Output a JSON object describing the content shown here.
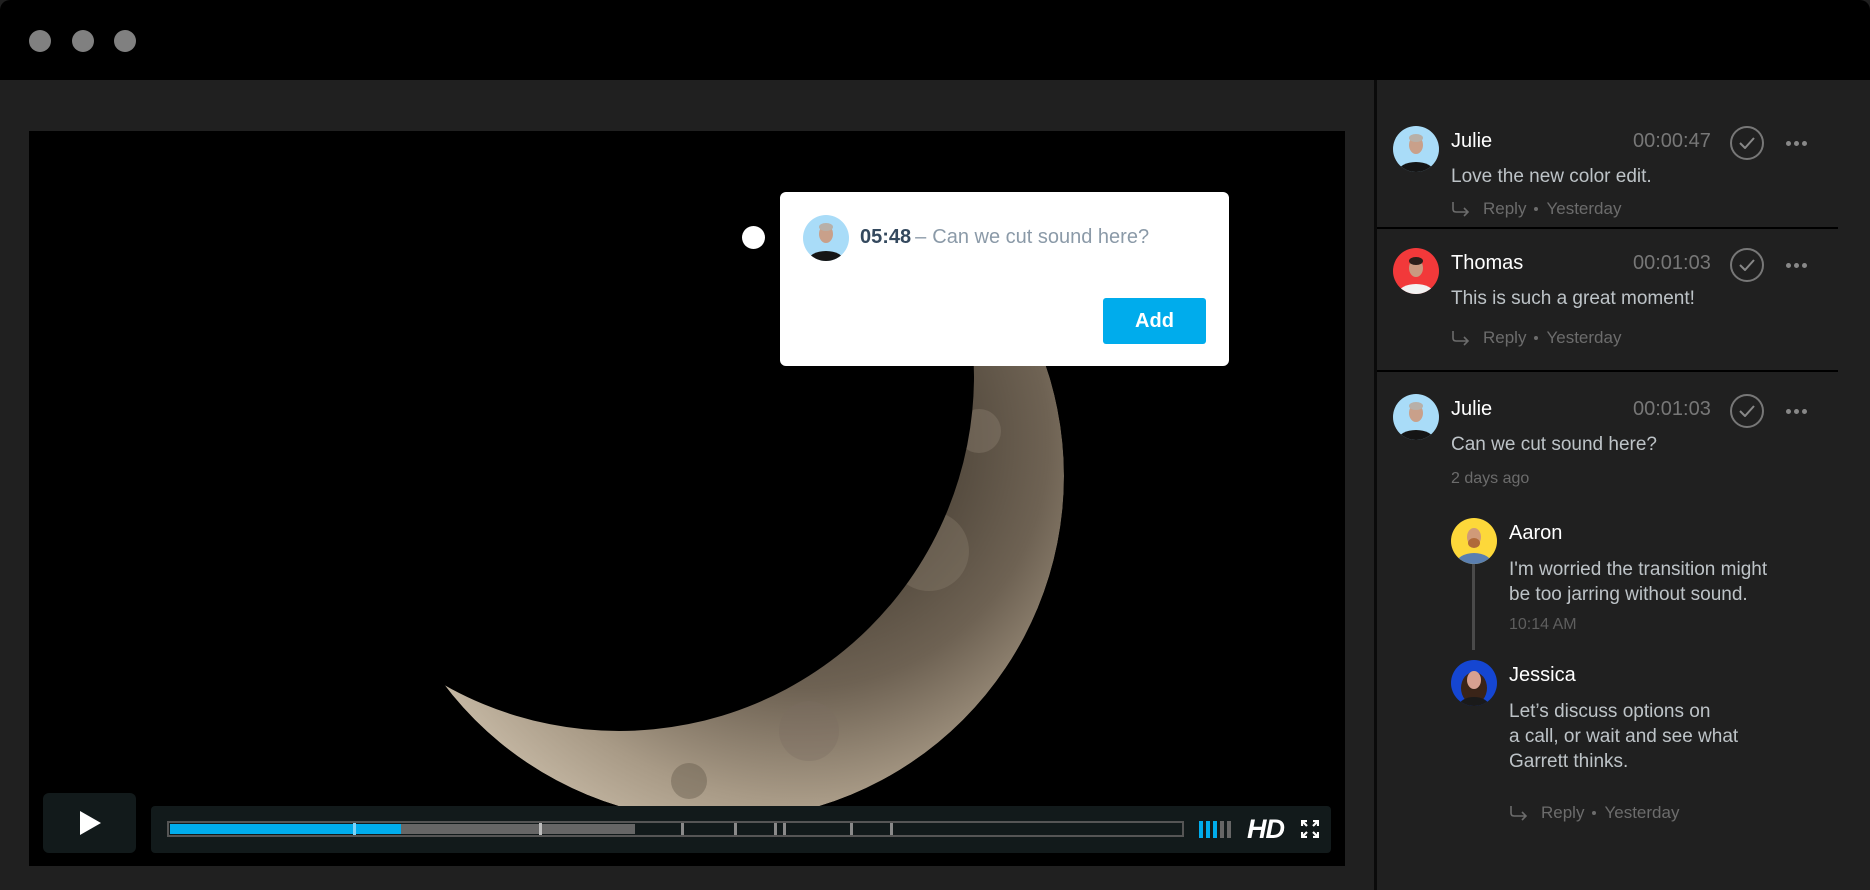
{
  "window": {
    "traffic_lights": [
      "close",
      "minimize",
      "maximize"
    ]
  },
  "player": {
    "state": "paused",
    "play_icon": "play-icon",
    "progress": {
      "played_fraction": 0.228,
      "buffered_fraction": 0.46,
      "comment_markers_fraction": [
        0.182,
        0.366,
        0.506,
        0.559,
        0.598,
        0.607,
        0.674,
        0.713
      ]
    },
    "volume_level": 3,
    "volume_max": 5,
    "quality_label": "HD",
    "fullscreen_icon": "fullscreen-icon",
    "colors": {
      "accent": "#00acec"
    }
  },
  "popup": {
    "timecode": "05:48",
    "dash": "–",
    "text": "Can we cut sound here?",
    "add_label": "Add"
  },
  "comments": [
    {
      "author": "Julie",
      "avatar_color": "#a9dcf8",
      "timecode": "00:00:47",
      "text": "Love the new color edit.",
      "reply_label": "Reply",
      "time": "Yesterday"
    },
    {
      "author": "Thomas",
      "avatar_color": "#f2393a",
      "timecode": "00:01:03",
      "text": "This is such a great moment!",
      "reply_label": "Reply",
      "time": "Yesterday"
    },
    {
      "author": "Julie",
      "avatar_color": "#a9dcf8",
      "timecode": "00:01:03",
      "text": "Can we cut sound here?",
      "time": "2 days ago",
      "replies": [
        {
          "author": "Aaron",
          "avatar_color": "#fdd83a",
          "text_lines": [
            "I'm worried the transition might",
            "be too jarring without sound."
          ],
          "time": "10:14 AM"
        },
        {
          "author": "Jessica",
          "avatar_color": "#1546d2",
          "text_lines": [
            "Let’s discuss options on",
            "a call, or wait and see what",
            "Garrett thinks."
          ]
        }
      ],
      "reply_label": "Reply",
      "reply_time": "Yesterday"
    }
  ]
}
